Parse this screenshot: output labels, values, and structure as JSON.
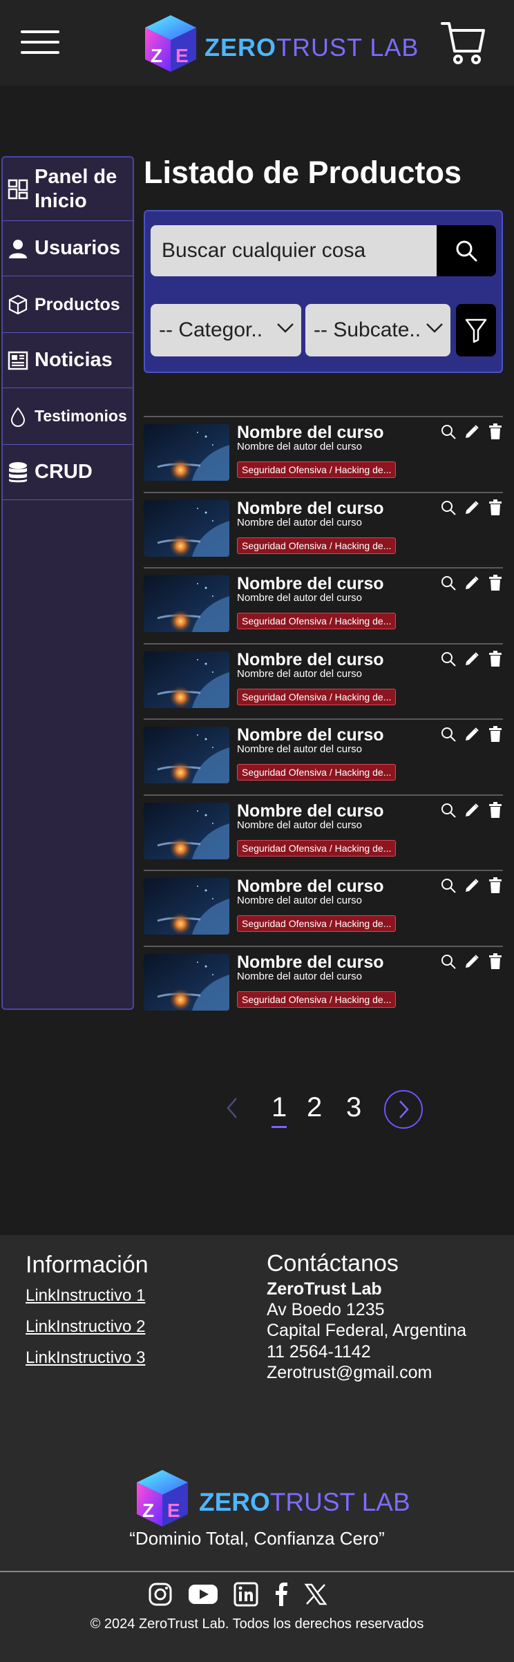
{
  "header": {
    "brand": {
      "part1": "ZERO",
      "part2": "TRUST LAB"
    }
  },
  "sidebar": {
    "items": [
      {
        "label": "Panel de Inicio",
        "icon": "dashboard-icon"
      },
      {
        "label": "Usuarios",
        "icon": "user-icon"
      },
      {
        "label": "Productos",
        "icon": "box-icon"
      },
      {
        "label": "Noticias",
        "icon": "newspaper-icon"
      },
      {
        "label": "Testimonios",
        "icon": "drop-icon"
      },
      {
        "label": "CRUD",
        "icon": "database-icon"
      }
    ]
  },
  "main": {
    "title": "Listado de Productos",
    "search": {
      "placeholder": "Buscar cualquier cosa"
    },
    "filters": {
      "category": "-- Categor..",
      "subcategory": "-- Subcate.."
    }
  },
  "courses": [
    {
      "name": "Nombre del curso",
      "author": "Nombre del autor del curso",
      "tag": "Seguridad Ofensiva / Hacking de..."
    },
    {
      "name": "Nombre del curso",
      "author": "Nombre del autor del curso",
      "tag": "Seguridad Ofensiva / Hacking de..."
    },
    {
      "name": "Nombre del curso",
      "author": "Nombre del autor del curso",
      "tag": "Seguridad Ofensiva / Hacking de..."
    },
    {
      "name": "Nombre del curso",
      "author": "Nombre del autor del curso",
      "tag": "Seguridad Ofensiva / Hacking de..."
    },
    {
      "name": "Nombre del curso",
      "author": "Nombre del autor del curso",
      "tag": "Seguridad Ofensiva / Hacking de..."
    },
    {
      "name": "Nombre del curso",
      "author": "Nombre del autor del curso",
      "tag": "Seguridad Ofensiva / Hacking de..."
    },
    {
      "name": "Nombre del curso",
      "author": "Nombre del autor del curso",
      "tag": "Seguridad Ofensiva / Hacking de..."
    },
    {
      "name": "Nombre del curso",
      "author": "Nombre del autor del curso",
      "tag": "Seguridad Ofensiva / Hacking de..."
    }
  ],
  "pagination": {
    "pages": [
      "1",
      "2",
      "3"
    ],
    "current": "1"
  },
  "footer": {
    "info_title": "Información",
    "links": [
      "LinkInstructivo 1",
      "LinkInstructivo 2",
      "LinkInstructivo 3"
    ],
    "contact_title": "Contáctanos",
    "contact": {
      "company": "ZeroTrust Lab",
      "address": "Av Boedo 1235",
      "city": "Capital Federal, Argentina",
      "phone": "11 2564-1142",
      "email": "Zerotrust@gmail.com"
    },
    "slogan": "“Dominio Total, Confianza Cero”",
    "social": [
      "instagram-icon",
      "youtube-icon",
      "linkedin-icon",
      "facebook-icon",
      "x-icon"
    ],
    "copyright": "© 2024 ZeroTrust Lab. Todos los derechos reservados"
  },
  "colors": {
    "accent": "#7b62ff",
    "panel": "#2d2f86",
    "sidebar": "#2a2440",
    "tag": "#8c1520"
  }
}
